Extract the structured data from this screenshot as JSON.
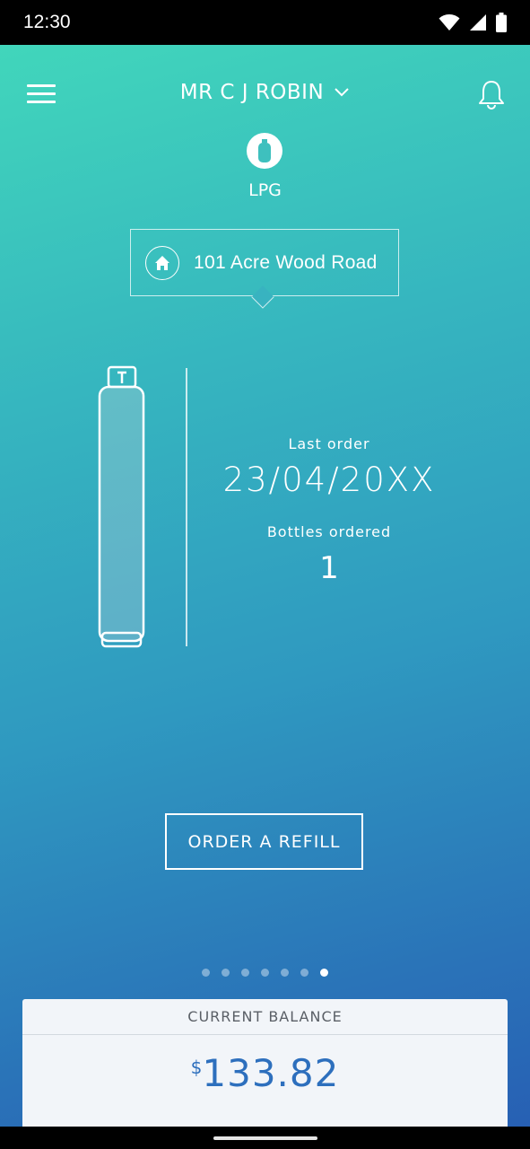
{
  "status_bar": {
    "time": "12:30"
  },
  "header": {
    "account_name": "MR C J ROBIN"
  },
  "fuel": {
    "label": "LPG"
  },
  "address": {
    "text": "101 Acre Wood Road"
  },
  "order_info": {
    "last_order_label": "Last order",
    "last_order_value": "23/04/20XX",
    "bottles_label": "Bottles ordered",
    "bottles_value": "1"
  },
  "actions": {
    "refill_label": "ORDER A REFILL"
  },
  "pagination": {
    "total": 7,
    "active_index": 6
  },
  "balance": {
    "title": "CURRENT BALANCE",
    "currency": "$",
    "amount": "133.82"
  },
  "colors": {
    "gradient_top": "#41d6bb",
    "gradient_bottom": "#2760b4",
    "balance_text": "#2d6fbd"
  }
}
